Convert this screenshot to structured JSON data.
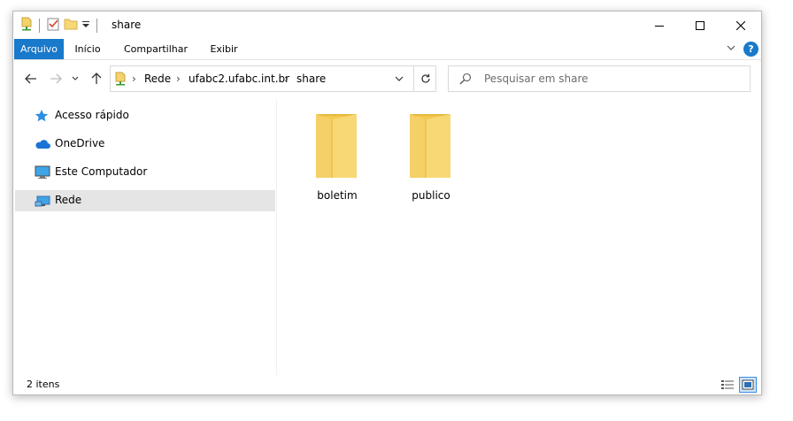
{
  "window": {
    "title": "share"
  },
  "ribbon": {
    "tabs": [
      "Arquivo",
      "Início",
      "Compartilhar",
      "Exibir"
    ],
    "help_label": "?"
  },
  "address": {
    "crumbs": [
      "Rede",
      "ufabc2.ufabc.int.br",
      "share"
    ]
  },
  "search": {
    "placeholder": "Pesquisar em share"
  },
  "navpane": {
    "items": [
      {
        "label": "Acesso rápido",
        "icon": "star-icon"
      },
      {
        "label": "OneDrive",
        "icon": "cloud-icon"
      },
      {
        "label": "Este Computador",
        "icon": "monitor-icon"
      },
      {
        "label": "Rede",
        "icon": "network-icon",
        "selected": true
      }
    ]
  },
  "content": {
    "folders": [
      {
        "name": "boletim"
      },
      {
        "name": "publico"
      }
    ]
  },
  "statusbar": {
    "item_count": "2 itens"
  },
  "colors": {
    "accent": "#1979ca",
    "selection": "#e5e5e5",
    "folder": "#f8d775"
  }
}
